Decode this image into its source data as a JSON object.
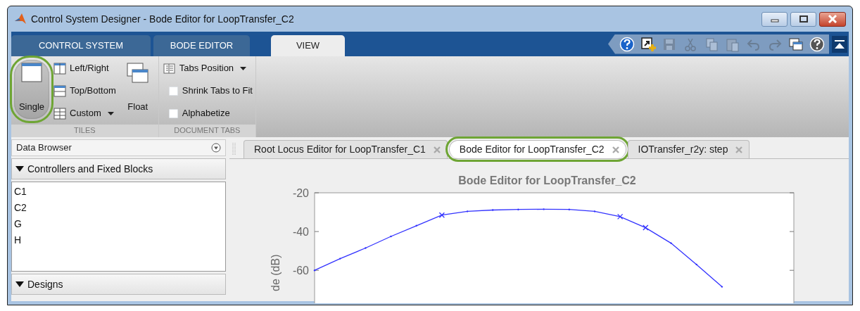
{
  "window": {
    "title": "Control System Designer - Bode Editor for LoopTransfer_C2"
  },
  "window_controls": [
    {
      "kind": "minimize"
    },
    {
      "kind": "maximize"
    },
    {
      "kind": "close"
    }
  ],
  "ribbon_tabs": [
    {
      "label": "CONTROL SYSTEM",
      "selected": false
    },
    {
      "label": "BODE EDITOR",
      "selected": false
    },
    {
      "label": "VIEW",
      "selected": true
    }
  ],
  "toolbar": [
    {
      "kind": "help",
      "disabled": false
    },
    {
      "kind": "new-plot",
      "disabled": false
    },
    {
      "kind": "save",
      "disabled": true
    },
    {
      "kind": "cut",
      "disabled": true
    },
    {
      "kind": "copy",
      "disabled": true
    },
    {
      "kind": "paste",
      "disabled": true
    },
    {
      "kind": "undo",
      "disabled": true
    },
    {
      "kind": "redo",
      "disabled": true
    },
    {
      "kind": "layout",
      "disabled": false
    },
    {
      "kind": "help-plain",
      "disabled": false
    },
    {
      "kind": "collapse",
      "disabled": false
    }
  ],
  "ribbon_groups": [
    {
      "label": "TILES",
      "columns": [
        [
          {
            "kind": "large",
            "label": "Single",
            "selected": true,
            "highlighted": true
          }
        ],
        [
          {
            "kind": "small",
            "label": "Left/Right"
          },
          {
            "kind": "small",
            "label": "Top/Bottom"
          },
          {
            "kind": "dropdown",
            "label": "Custom"
          }
        ],
        [
          {
            "kind": "large",
            "label": "Float",
            "selected": false,
            "highlighted": false
          }
        ]
      ]
    },
    {
      "label": "DOCUMENT TABS",
      "columns": [
        [
          {
            "kind": "dropdown",
            "label": "Tabs Position"
          },
          {
            "kind": "checkbox",
            "label": "Shrink Tabs to Fit",
            "checked": false
          },
          {
            "kind": "checkbox",
            "label": "Alphabetize",
            "checked": false
          }
        ]
      ]
    }
  ],
  "data_browser": {
    "title": "Data Browser",
    "sections": [
      {
        "label": "Controllers and Fixed Blocks",
        "expanded": true,
        "items": [
          "C1",
          "C2",
          "G",
          "H"
        ]
      },
      {
        "label": "Designs",
        "expanded": true
      }
    ]
  },
  "document_tabs": [
    {
      "label": "Root Locus Editor for LoopTransfer_C1",
      "selected": false,
      "highlighted": false
    },
    {
      "label": "Bode Editor for LoopTransfer_C2",
      "selected": true,
      "highlighted": true
    },
    {
      "label": "IOTransfer_r2y: step",
      "selected": false,
      "highlighted": false
    }
  ],
  "plot": {
    "chart_data": {
      "type": "line",
      "title": "Bode Editor for LoopTransfer_C2",
      "ylabel": "de (dB)",
      "ylim": [
        -77,
        -20
      ],
      "yticks": [
        {
          "value": -20,
          "label": "-20"
        },
        {
          "value": -40,
          "label": "-40"
        },
        {
          "value": -60,
          "label": "-60"
        }
      ],
      "categories": [
        null,
        null,
        null,
        null,
        null,
        null,
        null,
        null,
        null,
        null,
        null,
        null,
        null,
        null,
        null,
        null,
        null
      ],
      "series": [
        {
          "color": "#3333ff",
          "values": [
            -60,
            -54,
            -48.5,
            -42.5,
            -37,
            -31.5,
            -29.6,
            -28.9,
            -28.6,
            -28.5,
            -28.6,
            -29.6,
            -32.3,
            -38,
            -46,
            -57,
            -68.5
          ]
        }
      ]
    },
    "point_markers": [
      {
        "marked": false
      },
      {
        "marked": false
      },
      {
        "marked": false
      },
      {
        "marked": false
      },
      {
        "marked": false
      },
      {
        "marked": true
      },
      {
        "marked": false
      },
      {
        "marked": false
      },
      {
        "marked": false
      },
      {
        "marked": false
      },
      {
        "marked": false
      },
      {
        "marked": false
      },
      {
        "marked": true
      },
      {
        "marked": true
      },
      {
        "marked": false
      },
      {
        "marked": false
      },
      {
        "marked": false
      }
    ]
  }
}
